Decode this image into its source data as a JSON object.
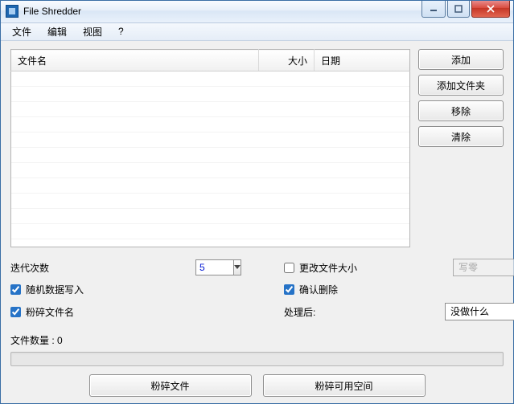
{
  "window": {
    "title": "File Shredder"
  },
  "menu": {
    "file": "文件",
    "edit": "编辑",
    "view": "视图",
    "help": "?"
  },
  "columns": {
    "name": "文件名",
    "size": "大小",
    "date": "日期"
  },
  "sideButtons": {
    "add": "添加",
    "addFolder": "添加文件夹",
    "remove": "移除",
    "clear": "清除"
  },
  "options": {
    "iterationsLabel": "迭代次数",
    "iterationsValue": "5",
    "changeFileSize": "更改文件大小",
    "wipeMethodSelected": "写零",
    "randomWrite": "随机数据写入",
    "confirmDelete": "确认删除",
    "shredFilename": "粉碎文件名",
    "afterLabel": "处理后:",
    "afterSelected": "没做什么"
  },
  "status": {
    "fileCountLabel": "文件数量 : 0"
  },
  "actions": {
    "shredFiles": "粉碎文件",
    "shredFreeSpace": "粉碎可用空间"
  },
  "checks": {
    "changeFileSize": false,
    "randomWrite": true,
    "confirmDelete": true,
    "shredFilename": true
  }
}
